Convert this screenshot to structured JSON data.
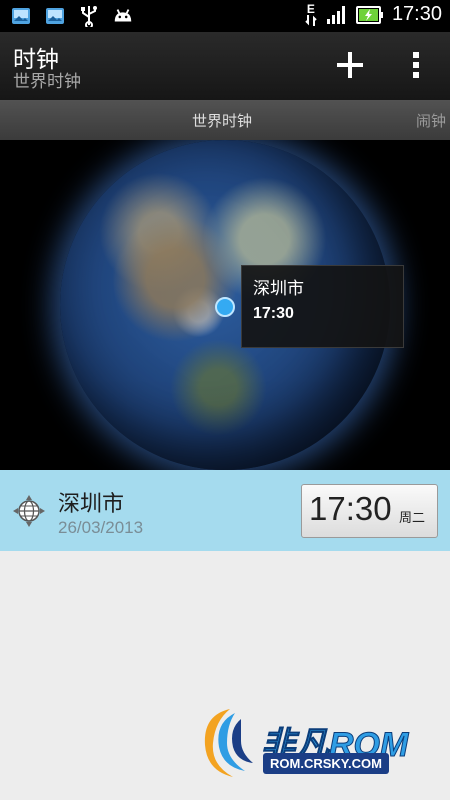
{
  "status_bar": {
    "time": "17:30",
    "network_type": "E",
    "left_icons": [
      "gallery-notification-icon",
      "gallery-notification-icon",
      "usb-icon",
      "android-debug-icon"
    ],
    "right_icons": [
      "network-e-icon",
      "signal-icon",
      "battery-charging-icon"
    ]
  },
  "action_bar": {
    "title": "时钟",
    "subtitle": "世界时钟",
    "add_icon": "plus-icon",
    "menu_icon": "overflow-menu-icon"
  },
  "tabs": [
    {
      "label": "世界时钟",
      "active": true
    },
    {
      "label": "闹钟",
      "active": false
    }
  ],
  "globe": {
    "popup": {
      "city": "深圳市",
      "time": "17:30"
    }
  },
  "city_list": [
    {
      "icon": "world-globe-icon",
      "city": "深圳市",
      "date": "26/03/2013",
      "time": "17:30",
      "weekday": "周二"
    }
  ],
  "watermark": {
    "brand": "非凡ROM",
    "url": "ROM.CRSKY.COM"
  },
  "colors": {
    "accent_blue": "#34aaf2",
    "selected_row": "#a5dbee",
    "action_bar": "#1e1e1e",
    "list_background": "#ededed"
  }
}
